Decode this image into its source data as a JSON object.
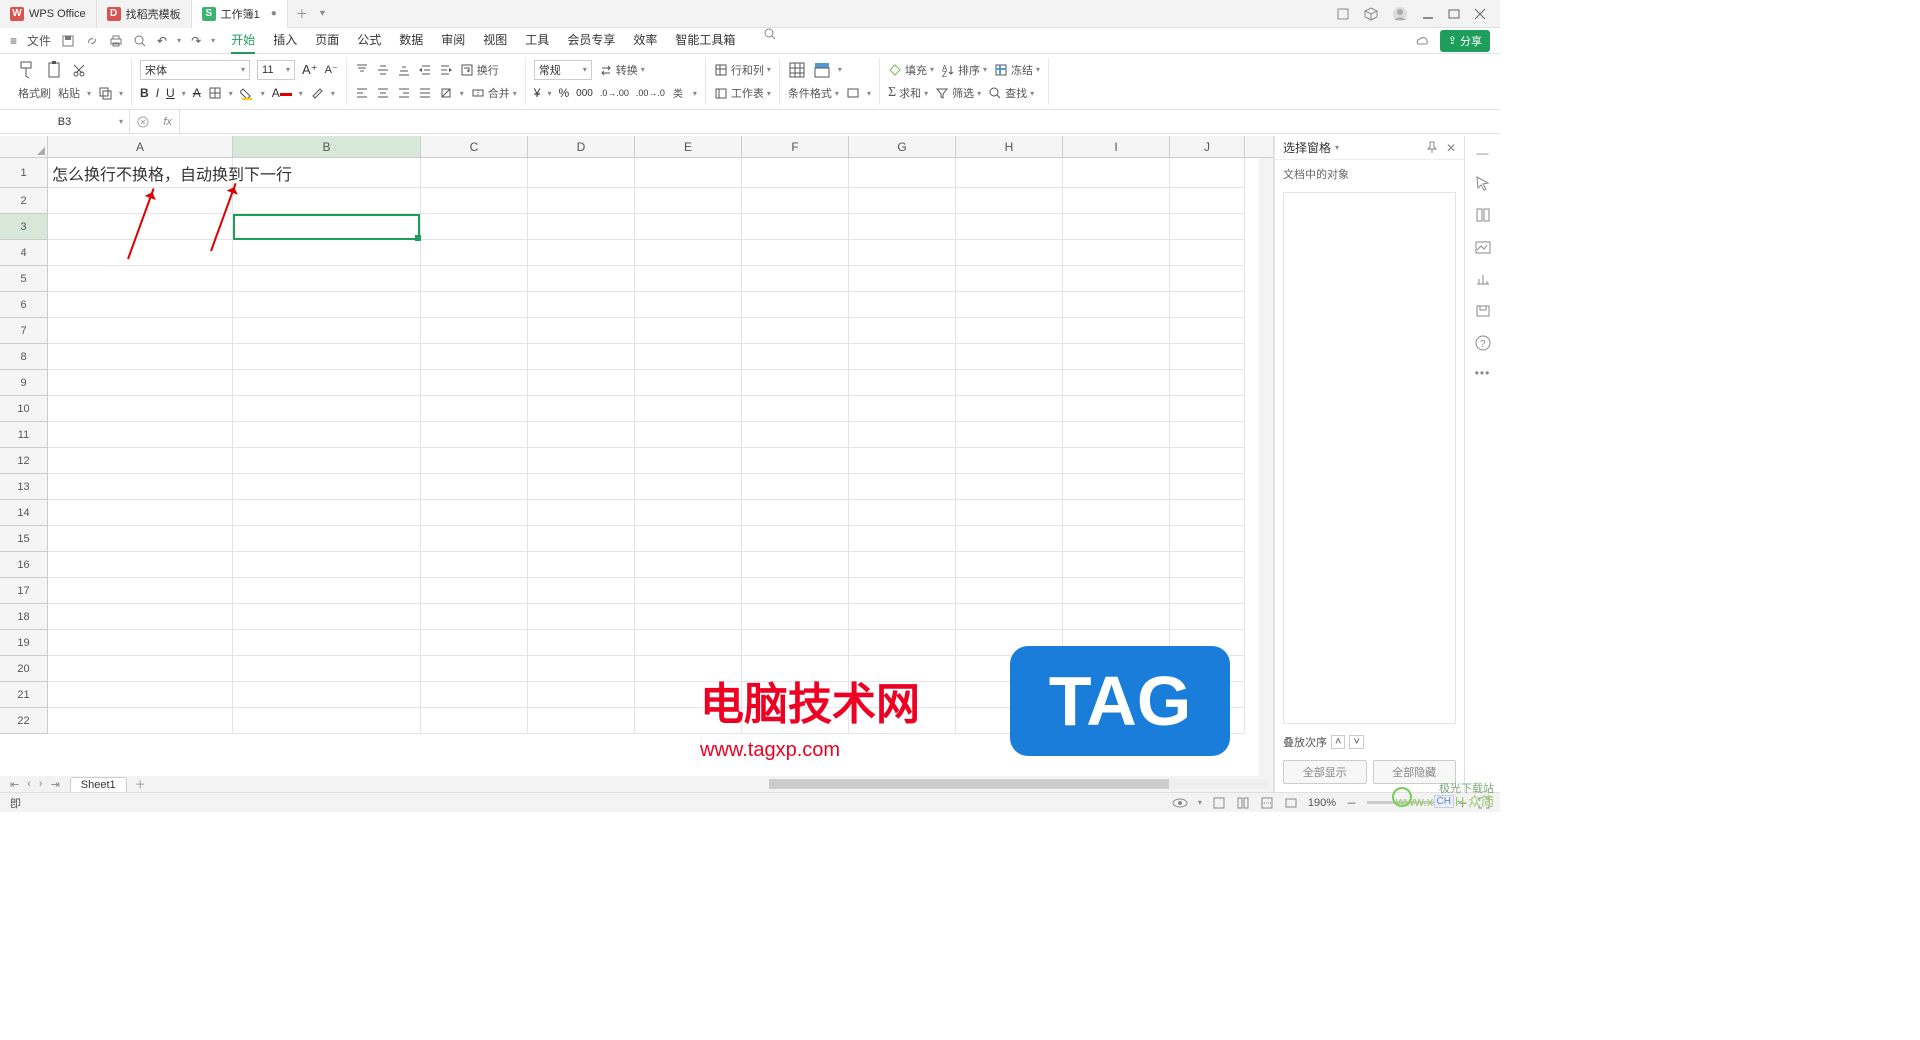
{
  "title_tabs": [
    {
      "icon": "ico-wps",
      "iconText": "W",
      "label": "WPS Office"
    },
    {
      "icon": "ico-d",
      "iconText": "D",
      "label": "找稻壳模板"
    },
    {
      "icon": "ico-s",
      "iconText": "S",
      "label": "工作簿1",
      "active": true,
      "closable": true
    }
  ],
  "menu": {
    "file": "文件",
    "tabs": [
      "开始",
      "插入",
      "页面",
      "公式",
      "数据",
      "审阅",
      "视图",
      "工具",
      "会员专享",
      "效率",
      "智能工具箱"
    ],
    "active": "开始"
  },
  "share_btn": "分享",
  "ribbon": {
    "format_brush": "格式刷",
    "paste": "粘贴",
    "font": "宋体",
    "font_size": "11",
    "wrap": "换行",
    "merge": "合并",
    "number_format": "常规",
    "convert": "转换",
    "rowcol": "行和列",
    "worksheet": "工作表",
    "cond_format": "条件格式",
    "fill": "填充",
    "sort": "排序",
    "freeze": "冻结",
    "sum": "求和",
    "filter": "筛选",
    "find": "查找"
  },
  "namebox": "B3",
  "columns": [
    "A",
    "B",
    "C",
    "D",
    "E",
    "F",
    "G",
    "H",
    "I",
    "J"
  ],
  "row_count": 22,
  "cell_text": "怎么换行不换格，自动换到下一行",
  "selected": {
    "col": "B",
    "row": 3
  },
  "sheet_tab": "Sheet1",
  "sidepane": {
    "title": "选择窗格",
    "subtitle": "文档中的对象",
    "order": "叠放次序",
    "show_all": "全部显示",
    "hide_all": "全部隐藏"
  },
  "status": {
    "zoom": "190%",
    "indicator": "卽"
  },
  "watermark": {
    "big": "电脑技术网",
    "url": "www.tagxp.com",
    "tag": "TAG",
    "site": "极光下载站",
    "site_url": "www.xE CH 众简"
  }
}
